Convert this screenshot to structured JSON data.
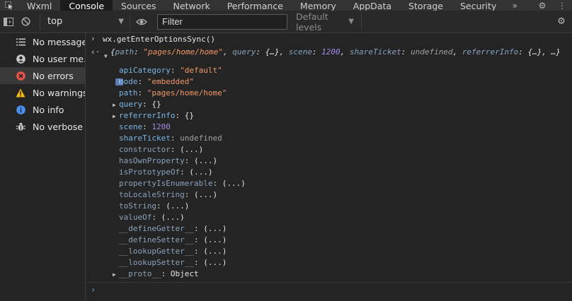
{
  "tabs": [
    {
      "label": "Wxml",
      "active": false
    },
    {
      "label": "Console",
      "active": true
    },
    {
      "label": "Sources",
      "active": false
    },
    {
      "label": "Network",
      "active": false
    },
    {
      "label": "Performance",
      "active": false
    },
    {
      "label": "Memory",
      "active": false
    },
    {
      "label": "AppData",
      "active": false
    },
    {
      "label": "Storage",
      "active": false
    },
    {
      "label": "Security",
      "active": false
    }
  ],
  "tab_overflow_icon": "double-chevron-icon",
  "toolbar": {
    "context": "top",
    "filter_placeholder": "Filter",
    "levels": "Default levels"
  },
  "sidebar": {
    "items": [
      {
        "label": "No messages",
        "icon": "list-icon",
        "selected": false
      },
      {
        "label": "No user me...",
        "icon": "user-icon",
        "selected": false
      },
      {
        "label": "No errors",
        "icon": "error-icon",
        "selected": true
      },
      {
        "label": "No warnings",
        "icon": "warning-icon",
        "selected": false
      },
      {
        "label": "No info",
        "icon": "info-icon",
        "selected": false
      },
      {
        "label": "No verbose",
        "icon": "bug-icon",
        "selected": false
      }
    ]
  },
  "console": {
    "command": "wx.getEnterOptionsSync()",
    "summary": {
      "path_key": "path",
      "path_val": "\"pages/home/home\"",
      "query_key": "query",
      "query_val": "{…}",
      "scene_key": "scene",
      "scene_val": "1200",
      "ticket_key": "shareTicket",
      "ticket_val": "undefined",
      "ref_key": "referrerInfo",
      "ref_val": "{…}",
      "tail": ", …}"
    },
    "props": [
      {
        "key": "apiCategory",
        "value": "\"default\"",
        "type": "string"
      },
      {
        "key": "mode",
        "value": "\"embedded\"",
        "type": "string"
      },
      {
        "key": "path",
        "value": "\"pages/home/home\"",
        "type": "string"
      },
      {
        "key": "query",
        "value": "{}",
        "type": "object",
        "expandable": true
      },
      {
        "key": "referrerInfo",
        "value": "{}",
        "type": "object",
        "expandable": true
      },
      {
        "key": "scene",
        "value": "1200",
        "type": "number"
      },
      {
        "key": "shareTicket",
        "value": "undefined",
        "type": "undefined"
      },
      {
        "key": "constructor",
        "value": "(...)",
        "type": "getter"
      },
      {
        "key": "hasOwnProperty",
        "value": "(...)",
        "type": "getter"
      },
      {
        "key": "isPrototypeOf",
        "value": "(...)",
        "type": "getter"
      },
      {
        "key": "propertyIsEnumerable",
        "value": "(...)",
        "type": "getter"
      },
      {
        "key": "toLocaleString",
        "value": "(...)",
        "type": "getter"
      },
      {
        "key": "toString",
        "value": "(...)",
        "type": "getter"
      },
      {
        "key": "valueOf",
        "value": "(...)",
        "type": "getter"
      },
      {
        "key": "__defineGetter__",
        "value": "(...)",
        "type": "getter"
      },
      {
        "key": "__defineSetter__",
        "value": "(...)",
        "type": "getter"
      },
      {
        "key": "__lookupGetter__",
        "value": "(...)",
        "type": "getter"
      },
      {
        "key": "__lookupSetter__",
        "value": "(...)",
        "type": "getter"
      },
      {
        "key": "__proto__",
        "value": "Object",
        "type": "proto",
        "expandable": true
      }
    ]
  },
  "colors": {
    "key": "#7ab6e6",
    "string": "#f29766",
    "number": "#a48ae6",
    "undefined": "#a0a0a0",
    "prompt": "#5da4f5",
    "selected_bg": "#393939"
  }
}
